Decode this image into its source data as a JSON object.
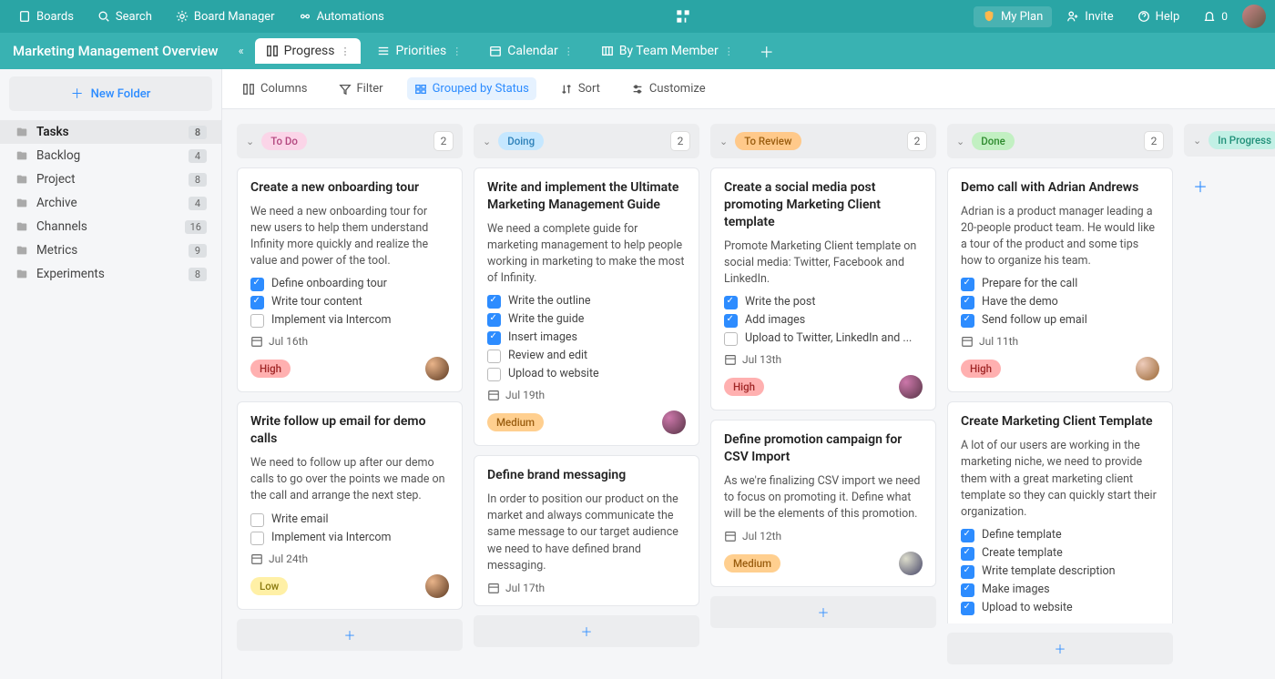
{
  "topbar": {
    "boards": "Boards",
    "search": "Search",
    "board_manager": "Board Manager",
    "automations": "Automations",
    "my_plan": "My Plan",
    "invite": "Invite",
    "help": "Help",
    "notif_count": "0"
  },
  "board_title": "Marketing Management Overview",
  "tabs": [
    {
      "label": "Progress",
      "active": true
    },
    {
      "label": "Priorities",
      "active": false
    },
    {
      "label": "Calendar",
      "active": false
    },
    {
      "label": "By Team Member",
      "active": false
    }
  ],
  "toolbar": {
    "columns": "Columns",
    "filter": "Filter",
    "group": "Grouped by Status",
    "sort": "Sort",
    "customize": "Customize"
  },
  "sidebar": {
    "new_folder": "New Folder",
    "items": [
      {
        "label": "Tasks",
        "count": "8",
        "active": true
      },
      {
        "label": "Backlog",
        "count": "4",
        "active": false
      },
      {
        "label": "Project",
        "count": "8",
        "active": false
      },
      {
        "label": "Archive",
        "count": "4",
        "active": false
      },
      {
        "label": "Channels",
        "count": "16",
        "active": false
      },
      {
        "label": "Metrics",
        "count": "9",
        "active": false
      },
      {
        "label": "Experiments",
        "count": "8",
        "active": false
      }
    ]
  },
  "columns": [
    {
      "status": "To Do",
      "pill_class": "pill-todo",
      "count": "2",
      "cards": [
        {
          "title": "Create a new onboarding tour",
          "desc": "We need a new onboarding tour for new users to help them understand Infinity more quickly and realize the value and power of the tool.",
          "checks": [
            {
              "done": true,
              "label": "Define onboarding tour"
            },
            {
              "done": true,
              "label": "Write tour content"
            },
            {
              "done": false,
              "label": "Implement via Intercom"
            }
          ],
          "date": "Jul 16th",
          "priority": "High",
          "priority_class": "prio-high",
          "avatar": "av1"
        },
        {
          "title": "Write follow up email for demo calls",
          "desc": "We need to follow up after our demo calls to go over the points we made on the call and arrange the next step.",
          "checks": [
            {
              "done": false,
              "label": "Write email"
            },
            {
              "done": false,
              "label": "Implement via Intercom"
            }
          ],
          "date": "Jul 24th",
          "priority": "Low",
          "priority_class": "prio-low",
          "avatar": "av1"
        }
      ]
    },
    {
      "status": "Doing",
      "pill_class": "pill-doing",
      "count": "2",
      "cards": [
        {
          "title": "Write and implement the Ultimate Marketing Management Guide",
          "desc": "We need a complete guide for marketing management to help people working in marketing to make the most of Infinity.",
          "checks": [
            {
              "done": true,
              "label": "Write the outline"
            },
            {
              "done": true,
              "label": "Write the guide"
            },
            {
              "done": true,
              "label": "Insert images"
            },
            {
              "done": false,
              "label": "Review and edit"
            },
            {
              "done": false,
              "label": "Upload to website"
            }
          ],
          "date": "Jul 19th",
          "priority": "Medium",
          "priority_class": "prio-medium",
          "avatar": "av2"
        },
        {
          "title": "Define brand messaging",
          "desc": "In order to position our product on the market and always communicate the same message to our target audience we need to have defined brand messaging.",
          "checks": [],
          "date": "Jul 17th",
          "priority": "",
          "priority_class": "",
          "avatar": ""
        }
      ]
    },
    {
      "status": "To Review",
      "pill_class": "pill-review",
      "count": "2",
      "cards": [
        {
          "title": "Create a social media post promoting Marketing Client template",
          "desc": "Promote Marketing Client template on social media: Twitter, Facebook and LinkedIn.",
          "checks": [
            {
              "done": true,
              "label": "Write the post"
            },
            {
              "done": true,
              "label": "Add images"
            },
            {
              "done": false,
              "label": "Upload to Twitter, LinkedIn and ..."
            }
          ],
          "date": "Jul 13th",
          "priority": "High",
          "priority_class": "prio-high",
          "avatar": "av2"
        },
        {
          "title": "Define promotion campaign for CSV Import",
          "desc": "As we're finalizing CSV import we need to focus on promoting it. Define what will be the elements of this promotion.",
          "checks": [],
          "date": "Jul 12th",
          "priority": "Medium",
          "priority_class": "prio-medium",
          "avatar": "av3"
        }
      ]
    },
    {
      "status": "Done",
      "pill_class": "pill-done",
      "count": "2",
      "cards": [
        {
          "title": "Demo call with Adrian Andrews",
          "desc": "Adrian is a product manager leading a 20-people product team. He would like a tour of the product and some tips how to organize his team.",
          "checks": [
            {
              "done": true,
              "label": "Prepare for the call"
            },
            {
              "done": true,
              "label": "Have the demo"
            },
            {
              "done": true,
              "label": "Send follow up email"
            }
          ],
          "date": "Jul 11th",
          "priority": "High",
          "priority_class": "prio-high",
          "avatar": "av4"
        },
        {
          "title": "Create Marketing Client Template",
          "desc": "A lot of our users are working in the marketing niche, we need to provide them with a great marketing client template so they can quickly start their organization.",
          "checks": [
            {
              "done": true,
              "label": "Define template"
            },
            {
              "done": true,
              "label": "Create template"
            },
            {
              "done": true,
              "label": "Write template description"
            },
            {
              "done": true,
              "label": "Make images"
            },
            {
              "done": true,
              "label": "Upload to website"
            }
          ],
          "date": "",
          "priority": "",
          "priority_class": "",
          "avatar": ""
        }
      ]
    },
    {
      "status": "In Progress",
      "pill_class": "pill-progress",
      "count": "",
      "cards": []
    }
  ]
}
